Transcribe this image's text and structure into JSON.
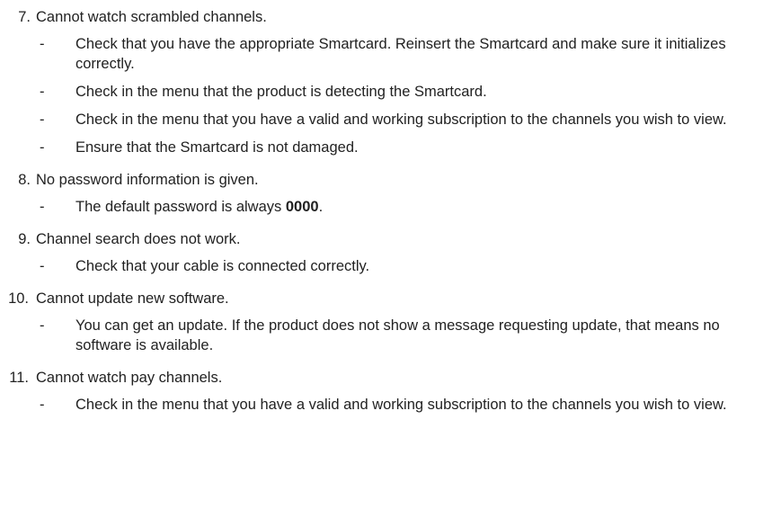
{
  "items": [
    {
      "number": "7.",
      "heading": "Cannot watch scrambled channels.",
      "bullets": [
        "Check that you have the appropriate Smartcard. Reinsert the Smartcard and make sure it initializes correctly.",
        "Check in the menu that the product is detecting the Smartcard.",
        "Check in the menu that you have a valid and working subscription to the channels you wish to view.",
        "Ensure that the Smartcard is not damaged."
      ]
    },
    {
      "number": "8.",
      "heading": "No password information is given.",
      "bullet_prefix": "The default password is always ",
      "bullet_bold": "0000",
      "bullet_suffix": "."
    },
    {
      "number": "9.",
      "heading": "Channel search does not work.",
      "bullets": [
        "Check that your cable is connected correctly."
      ]
    },
    {
      "number": "10.",
      "heading": "Cannot update new software.",
      "bullets": [
        "You can get an update. If the product does not show a message requesting update, that means no software is available."
      ]
    },
    {
      "number": "11.",
      "heading": "Cannot watch pay channels.",
      "bullets": [
        "Check in the menu that you have a valid and working subscription to the channels you wish to view."
      ]
    }
  ],
  "dash": "-"
}
